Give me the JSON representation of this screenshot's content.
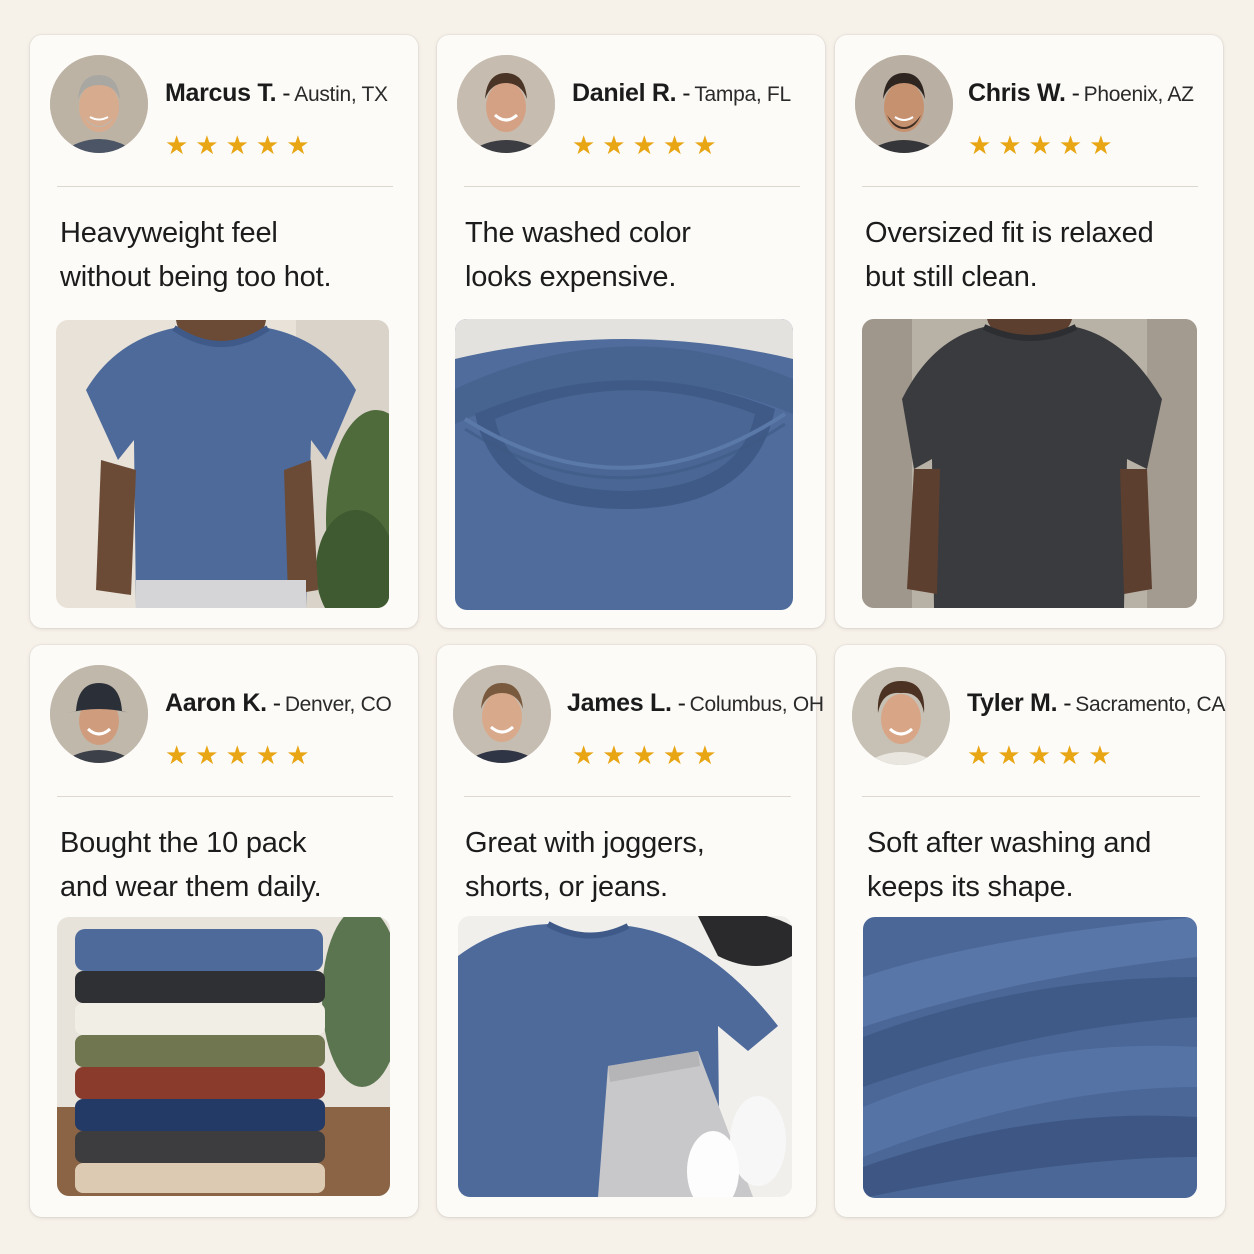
{
  "reviews": [
    {
      "name": "Marcus T.",
      "separator": "-",
      "location": "Austin, TX",
      "rating": 5,
      "stars": "★★★★★",
      "quote_line1": "Heavyweight feel",
      "quote_line2": "without being too hot.",
      "photo_icon": "person-blue-tee-photo"
    },
    {
      "name": "Daniel R.",
      "separator": "-",
      "location": "Tampa, FL",
      "rating": 5,
      "stars": "★★★★★",
      "quote_line1": "The washed color",
      "quote_line2": "looks expensive.",
      "photo_icon": "collar-closeup-photo"
    },
    {
      "name": "Chris W.",
      "separator": "-",
      "location": "Phoenix, AZ",
      "rating": 5,
      "stars": "★★★★★",
      "quote_line1": "Oversized fit is relaxed",
      "quote_line2": "but still clean.",
      "photo_icon": "person-charcoal-tee-photo"
    },
    {
      "name": "Aaron K.",
      "separator": "-",
      "location": "Denver, CO",
      "rating": 5,
      "stars": "★★★★★",
      "quote_line1": "Bought the 10 pack",
      "quote_line2": "and wear them daily.",
      "photo_icon": "folded-stack-photo"
    },
    {
      "name": "James L.",
      "separator": "-",
      "location": "Columbus, OH",
      "rating": 5,
      "stars": "★★★★★",
      "quote_line1": "Great with joggers,",
      "quote_line2": "shorts, or jeans.",
      "photo_icon": "flatlay-outfit-photo"
    },
    {
      "name": "Tyler M.",
      "separator": "-",
      "location": "Sacramento, CA",
      "rating": 5,
      "stars": "★★★★★",
      "quote_line1": "Soft after washing and",
      "quote_line2": "keeps its shape.",
      "photo_icon": "fabric-closeup-photo"
    }
  ],
  "colors": {
    "background": "#f6f1e9",
    "card": "#fcfbf8",
    "star": "#e8a514",
    "shirt_blue": "#4d6a9b",
    "shirt_charcoal": "#3a3b3e"
  }
}
